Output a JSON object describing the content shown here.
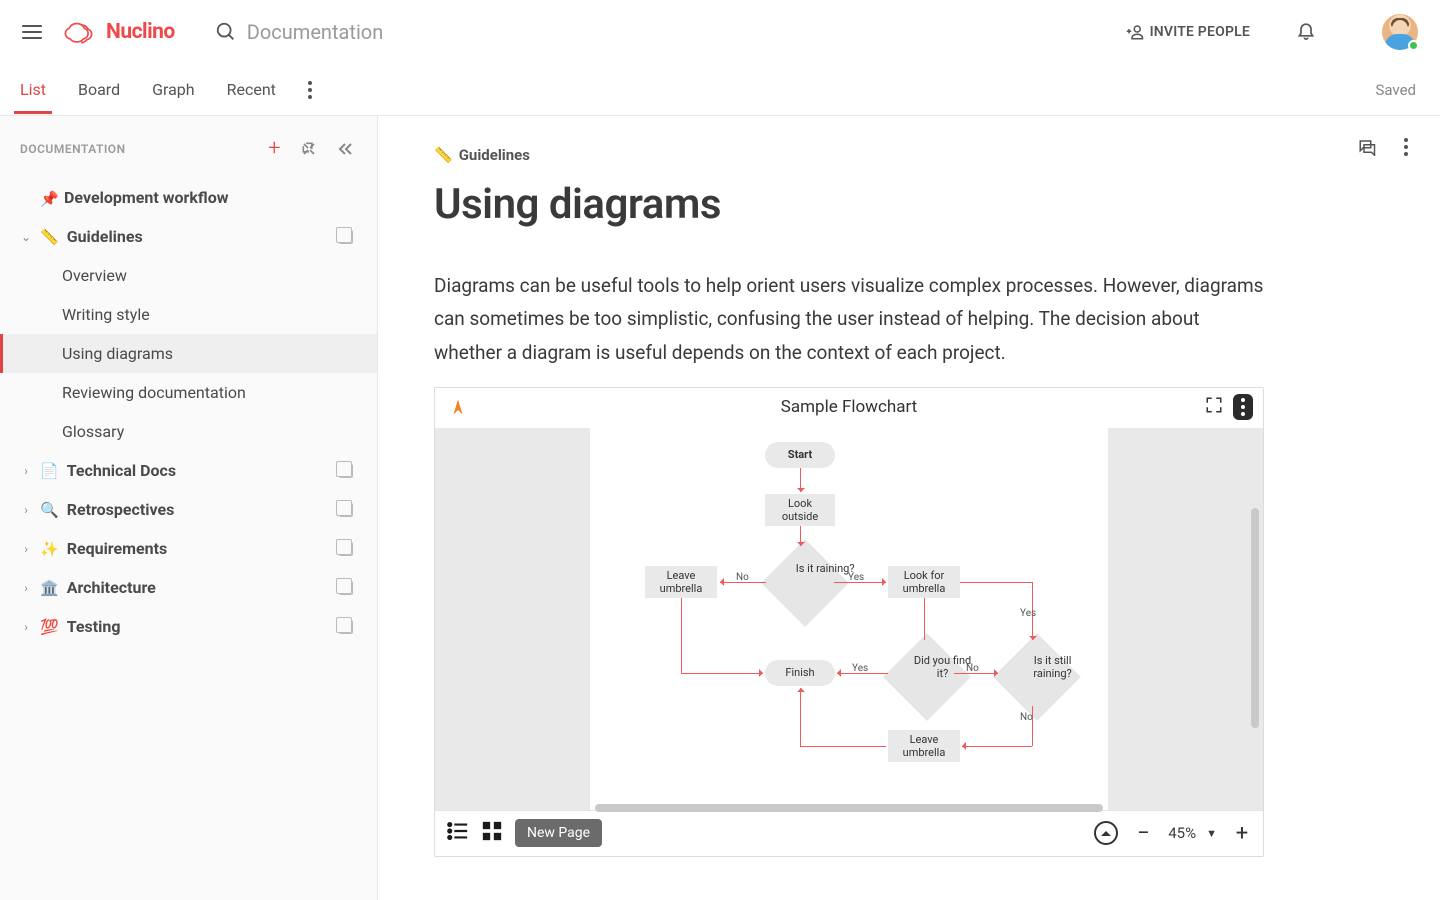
{
  "header": {
    "brand": "Nuclino",
    "search_placeholder": "Documentation",
    "invite_label": "INVITE PEOPLE"
  },
  "tabs": {
    "items": [
      "List",
      "Board",
      "Graph",
      "Recent"
    ],
    "active_index": 0,
    "saved_label": "Saved"
  },
  "sidebar": {
    "title": "DOCUMENTATION",
    "items": [
      {
        "label": "Development workflow",
        "pin": true,
        "bold": true
      },
      {
        "emoji": "📏",
        "label": "Guidelines",
        "expanded": true,
        "bold": true,
        "copy": true,
        "children": [
          {
            "label": "Overview"
          },
          {
            "label": "Writing style"
          },
          {
            "label": "Using diagrams",
            "active": true
          },
          {
            "label": "Reviewing documentation"
          },
          {
            "label": "Glossary"
          }
        ]
      },
      {
        "emoji": "📄",
        "label": "Technical Docs",
        "bold": true,
        "collapsed": true,
        "copy": true
      },
      {
        "emoji": "🔍",
        "label": "Retrospectives",
        "bold": true,
        "collapsed": true,
        "copy": true
      },
      {
        "emoji": "✨",
        "label": "Requirements",
        "bold": true,
        "collapsed": true,
        "copy": true
      },
      {
        "emoji": "🏛️",
        "label": "Architecture",
        "bold": true,
        "collapsed": true,
        "copy": true
      },
      {
        "emoji": "💯",
        "label": "Testing",
        "bold": true,
        "collapsed": true,
        "copy": true
      }
    ]
  },
  "doc": {
    "breadcrumb_emoji": "📏",
    "breadcrumb": "Guidelines",
    "title": "Using diagrams",
    "paragraph": "Diagrams can be useful tools to help orient users visualize complex processes. However, diagrams can sometimes be too simplistic, confusing the user instead of helping. The decision about whether a diagram is useful depends on the context of each project."
  },
  "embed": {
    "title": "Sample Flowchart",
    "new_page": "New Page",
    "zoom": "45%",
    "nodes": {
      "start": "Start",
      "look_outside": "Look outside",
      "is_raining": "Is it raining?",
      "leave_umbrella": "Leave umbrella",
      "look_for_umbrella": "Look for umbrella",
      "did_find": "Did you find it?",
      "still_raining": "Is it still raining?",
      "finish": "Finish",
      "leave_umbrella_2": "Leave umbrella"
    },
    "labels": {
      "yes": "Yes",
      "no": "No"
    }
  }
}
